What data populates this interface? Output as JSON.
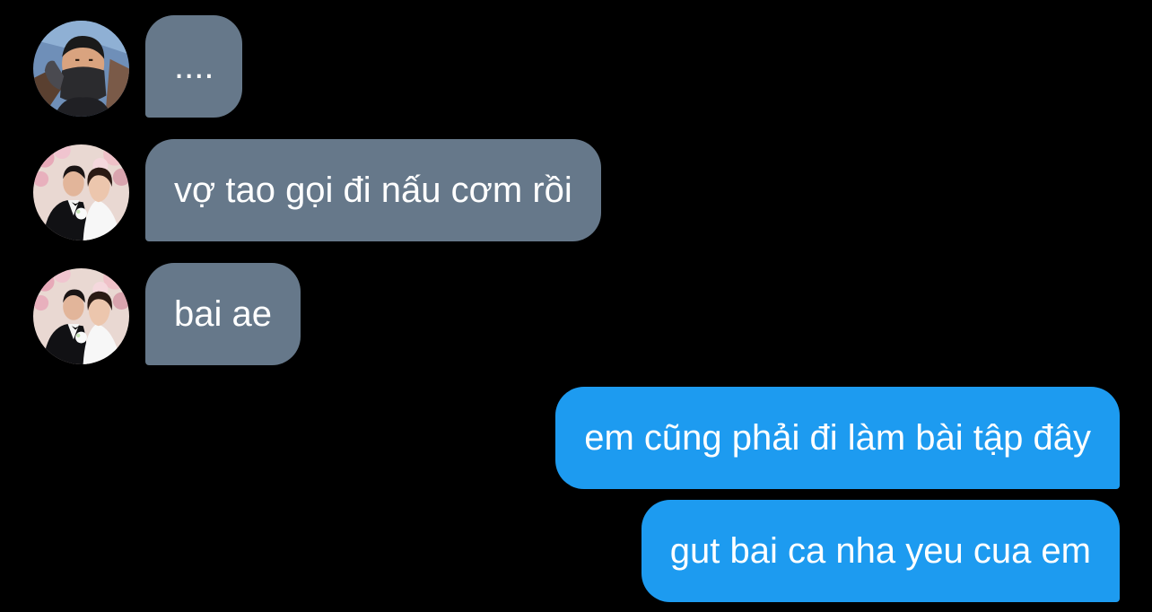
{
  "conversation": {
    "messages": [
      {
        "direction": "incoming",
        "sender_avatar": "avatar-masked-man",
        "text": "...."
      },
      {
        "direction": "incoming",
        "sender_avatar": "avatar-wedding-couple",
        "text": "vợ tao gọi đi nấu cơm rồi"
      },
      {
        "direction": "incoming",
        "sender_avatar": "avatar-wedding-couple",
        "text": "bai ae"
      },
      {
        "direction": "outgoing",
        "text": "em cũng phải đi làm bài tập đây"
      },
      {
        "direction": "outgoing",
        "text": "gut bai ca nha yeu cua em"
      }
    ]
  },
  "colors": {
    "background": "#000000",
    "incoming_bubble": "#66788a",
    "outgoing_bubble": "#1d9bf0",
    "text": "#ffffff"
  }
}
